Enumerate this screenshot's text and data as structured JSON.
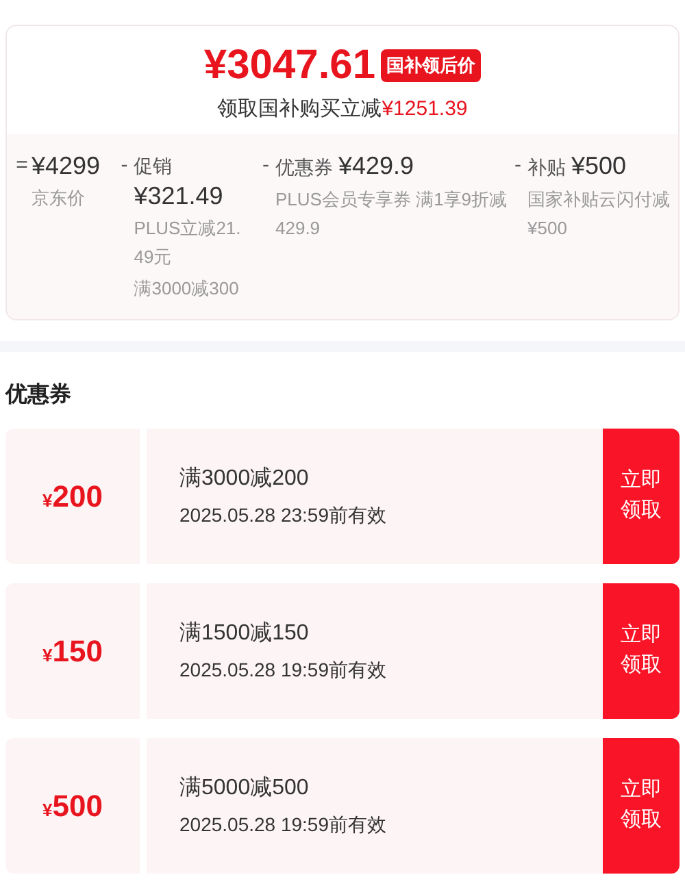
{
  "price_summary": {
    "final_price": "¥3047.61",
    "price_tag": "国补领后价",
    "saving_label": "领取国补购买立减",
    "saving_amount": "¥1251.39"
  },
  "breakdown": [
    {
      "op": "=",
      "amount": "¥4299",
      "notes": [
        "京东价"
      ]
    },
    {
      "op": "-",
      "label": "促销",
      "amount": "¥321.49",
      "notes": [
        "PLUS立减21.49元",
        "满3000减300"
      ]
    },
    {
      "op": "-",
      "label": "优惠券",
      "amount": "¥429.9",
      "notes": [
        "PLUS会员专享券 满1享9折减429.9"
      ]
    },
    {
      "op": "-",
      "label": "补贴",
      "amount": "¥500",
      "notes": [
        "国家补贴云闪付减¥500"
      ]
    }
  ],
  "coupons_section": {
    "title": "优惠券",
    "coupons": [
      {
        "currency": "¥",
        "amount": "200",
        "condition": "满3000减200",
        "validity": "2025.05.28 23:59前有效",
        "button": "立即领取"
      },
      {
        "currency": "¥",
        "amount": "150",
        "condition": "满1500减150",
        "validity": "2025.05.28 19:59前有效",
        "button": "立即领取"
      },
      {
        "currency": "¥",
        "amount": "500",
        "condition": "满5000减500",
        "validity": "2025.05.28 19:59前有效",
        "button": "立即领取"
      }
    ]
  }
}
